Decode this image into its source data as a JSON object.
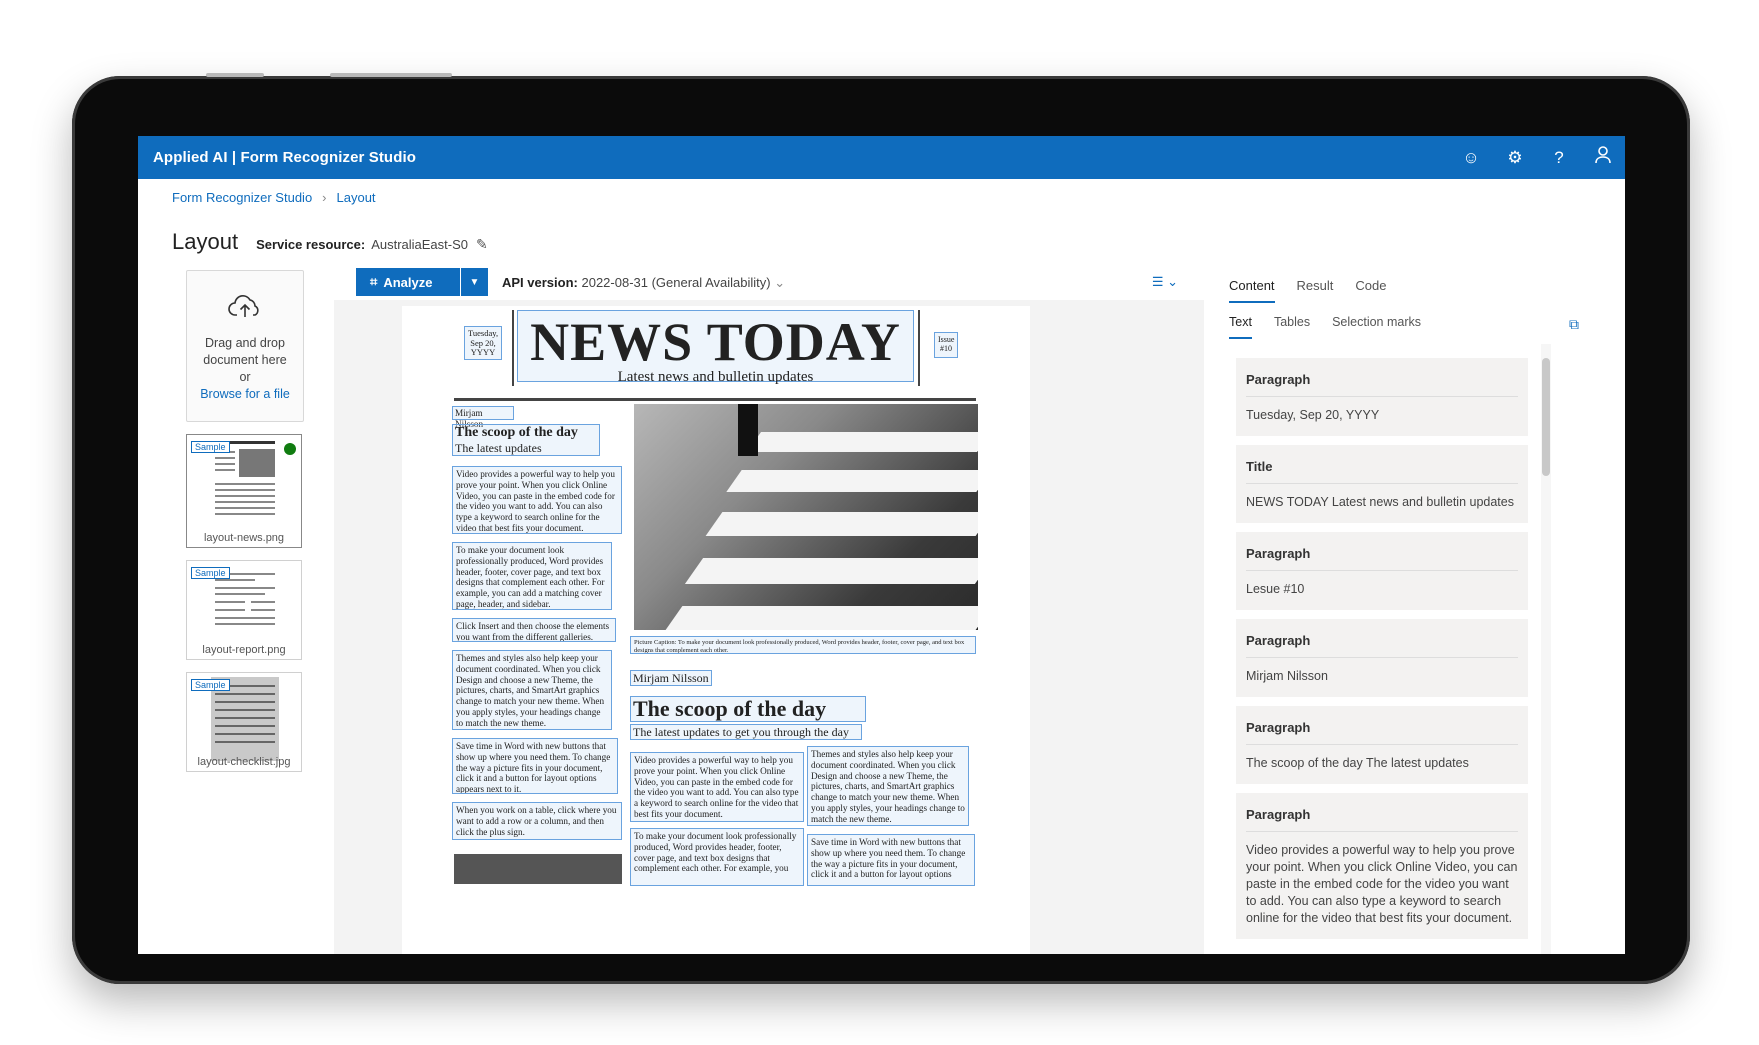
{
  "header": {
    "app_title": "Applied AI | Form Recognizer Studio"
  },
  "header_icons": [
    "smiley-icon",
    "gear-icon",
    "help-icon",
    "user-icon"
  ],
  "breadcrumb": {
    "root": "Form Recognizer Studio",
    "current": "Layout"
  },
  "page": {
    "title": "Layout",
    "service_label": "Service resource:",
    "service_value": "AustraliaEast-S0"
  },
  "upload": {
    "line1": "Drag and drop",
    "line2": "document here",
    "line3": "or",
    "browse": "Browse for a file"
  },
  "files": [
    {
      "name": "layout-news.png",
      "badge": "Sample"
    },
    {
      "name": "layout-report.png",
      "badge": "Sample"
    },
    {
      "name": "layout-checklist.jpg",
      "badge": "Sample"
    }
  ],
  "toolbar": {
    "analyze": "Analyze",
    "api_label": "API version:",
    "api_value": "2022-08-31 (General Availability)"
  },
  "document": {
    "date": "Tuesday, Sep 20, YYYY",
    "title": "NEWS TODAY",
    "subtitle": "Latest news and bulletin updates",
    "issue": "Issue #10",
    "author": "Mirjam Nilsson",
    "scoop": "The scoop of the day",
    "latest": "The latest updates",
    "p1": "Video provides a powerful way to help you prove your point. When you click Online Video, you can paste in the embed code for the video you want to add. You can also type a keyword to search online for the video that best fits your document.",
    "p2": "To make your document look professionally produced, Word provides header, footer, cover page, and text box designs that complement each other. For example, you can add a matching cover page, header, and sidebar.",
    "p3": "Click Insert and then choose the elements you want from the different galleries.",
    "p4": "Themes and styles also help keep your document coordinated. When you click Design and choose a new Theme, the pictures, charts, and SmartArt graphics change to match your new theme. When you apply styles, your headings change to match the new theme.",
    "p5": "Save time in Word with new buttons that show up where you need them. To change the way a picture fits in your document, click it and a button for layout options appears next to it.",
    "p6": "When you work on a table, click where you want to add a row or a column, and then click the plus sign.",
    "caption": "Picture Caption: To make your document look professionally produced, Word provides header, footer, cover page, and text box designs that complement each other.",
    "author2": "Mirjam Nilsson",
    "scoop2": "The scoop of the day",
    "latest2": "The latest updates to get you through the day",
    "c1": "Video provides a powerful way to help you prove your point. When you click Online Video, you can paste in the embed code for the video you want to add. You can also type a keyword to search online for the video that best fits your document.",
    "c2": "Themes and styles also help keep your document coordinated. When you click Design and choose a new Theme, the pictures, charts, and SmartArt graphics change to match your new theme. When you apply styles, your headings change to match the new theme.",
    "c3": "To make your document look professionally produced, Word provides header, footer, cover page, and text box designs that complement each other. For example, you",
    "c4": "Save time in Word with new buttons that show up where you need them. To change the way a picture fits in your document, click it and a button for layout options"
  },
  "right": {
    "tabs": [
      "Content",
      "Result",
      "Code"
    ],
    "subtabs": [
      "Text",
      "Tables",
      "Selection marks"
    ],
    "cards": [
      {
        "type": "Paragraph",
        "text": "Tuesday, Sep 20, YYYY"
      },
      {
        "type": "Title",
        "text": "NEWS TODAY Latest news and bulletin updates"
      },
      {
        "type": "Paragraph",
        "text": "Lesue #10"
      },
      {
        "type": "Paragraph",
        "text": "Mirjam Nilsson"
      },
      {
        "type": "Paragraph",
        "text": "The scoop of the day The latest updates"
      },
      {
        "type": "Paragraph",
        "text": "Video provides a powerful way to help you prove your point. When you click Online Video, you can paste in the embed code for the video you want to add. You can also type a keyword to search online for the video that best fits your document."
      }
    ]
  },
  "colors": {
    "brand": "#0f6cbd",
    "highlight": "#6aa3df",
    "success": "#107c10"
  }
}
